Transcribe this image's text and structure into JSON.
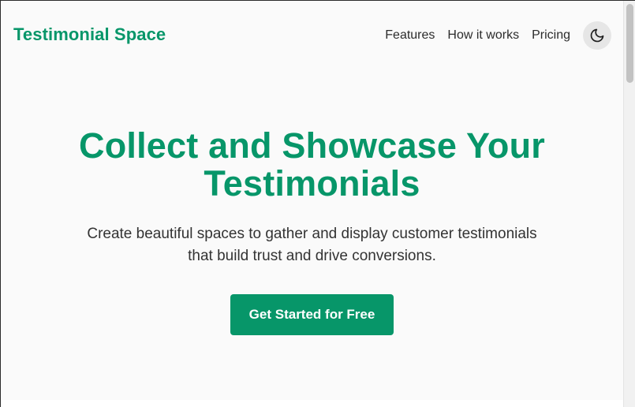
{
  "header": {
    "brand": "Testimonial Space",
    "nav": [
      {
        "label": "Features"
      },
      {
        "label": "How it works"
      },
      {
        "label": "Pricing"
      }
    ],
    "theme_toggle_icon": "moon-icon"
  },
  "hero": {
    "title_line1": "Collect and Showcase Your",
    "title_line2": "Testimonials",
    "subtitle_line1": "Create beautiful spaces to gather and display customer testimonials",
    "subtitle_line2": "that build trust and drive conversions.",
    "cta_label": "Get Started for Free"
  },
  "colors": {
    "brand": "#079669",
    "background": "#fafafa",
    "text": "#2c2c2c",
    "toggle_bg": "#e6e6e6"
  }
}
